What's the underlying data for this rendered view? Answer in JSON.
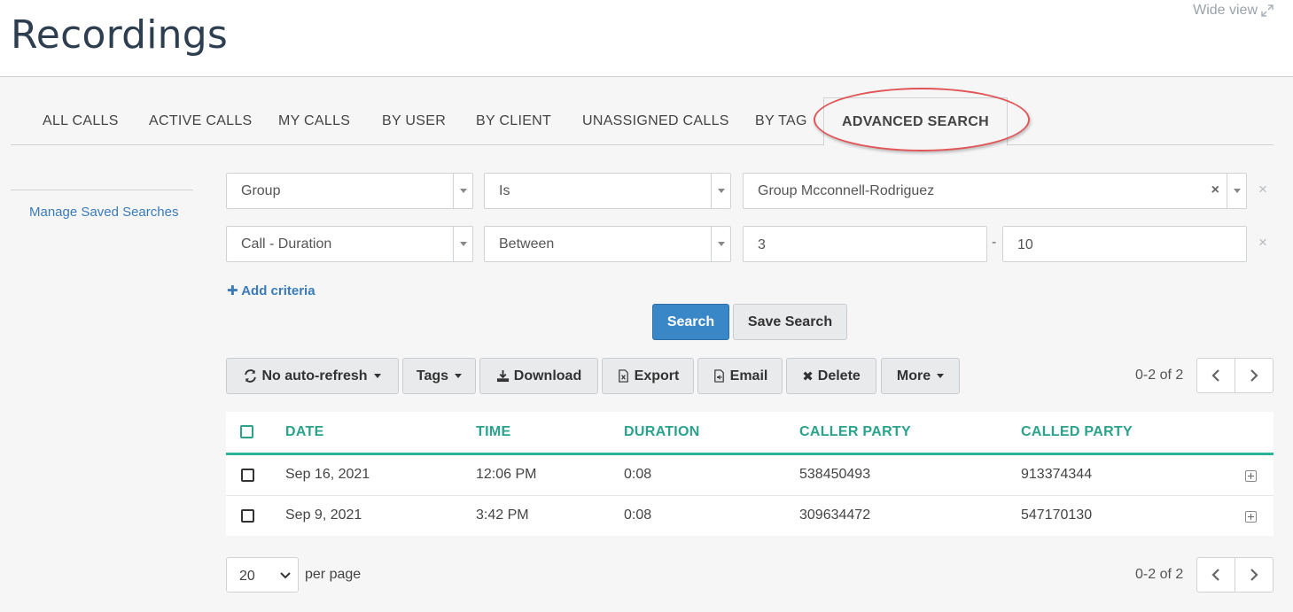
{
  "header": {
    "title": "Recordings",
    "wide_view_label": "Wide view"
  },
  "tabs": [
    {
      "label": "ALL CALLS",
      "active": false
    },
    {
      "label": "ACTIVE CALLS",
      "active": false
    },
    {
      "label": "MY CALLS",
      "active": false
    },
    {
      "label": "BY USER",
      "active": false
    },
    {
      "label": "BY CLIENT",
      "active": false
    },
    {
      "label": "UNASSIGNED CALLS",
      "active": false
    },
    {
      "label": "BY TAG",
      "active": false
    },
    {
      "label": "ADVANCED SEARCH",
      "active": true
    }
  ],
  "sidebar": {
    "manage_saved_searches": "Manage Saved Searches"
  },
  "criteria": [
    {
      "field": "Group",
      "operator": "Is",
      "value": "Group Mcconnell-Rodriguez"
    },
    {
      "field": "Call - Duration",
      "operator": "Between",
      "from": "3",
      "separator": "-",
      "to": "10"
    }
  ],
  "add_criteria_label": "Add criteria",
  "actions": {
    "search_label": "Search",
    "save_search_label": "Save Search"
  },
  "toolbar": {
    "auto_refresh_label": "No auto-refresh",
    "tags_label": "Tags",
    "download_label": "Download",
    "export_label": "Export",
    "email_label": "Email",
    "delete_label": "Delete",
    "more_label": "More"
  },
  "pagination": {
    "range_text": "0-2 of 2"
  },
  "table": {
    "columns": [
      "DATE",
      "TIME",
      "DURATION",
      "CALLER PARTY",
      "CALLED PARTY"
    ],
    "rows": [
      {
        "date": "Sep 16, 2021",
        "time": "12:06 PM",
        "duration": "0:08",
        "caller": "538450493",
        "called": "913374344"
      },
      {
        "date": "Sep 9, 2021",
        "time": "3:42 PM",
        "duration": "0:08",
        "caller": "309634472",
        "called": "547170130"
      }
    ]
  },
  "per_page": {
    "selected": "20",
    "label": "per page"
  },
  "colors": {
    "accent_teal": "#2aa28c",
    "primary_blue": "#3a87c8",
    "link_blue": "#3a7bb8",
    "highlight_red": "#e05656"
  }
}
